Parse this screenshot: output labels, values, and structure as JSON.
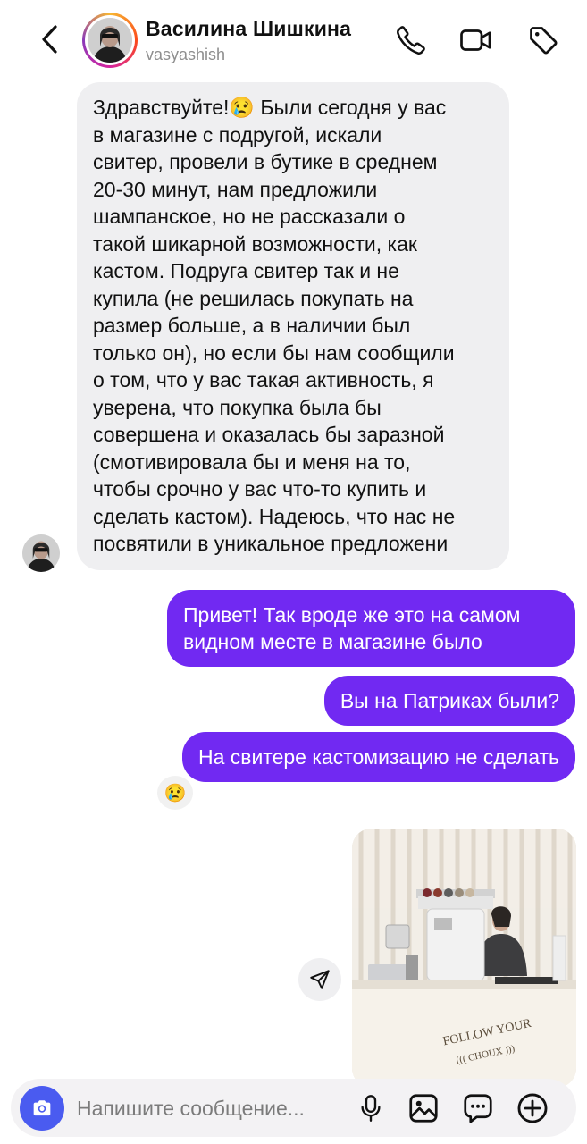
{
  "header": {
    "name": "Василина Шишкина",
    "username": "vasyashish",
    "icons": [
      "back-icon",
      "phone-icon",
      "video-camera-icon",
      "tag-icon"
    ]
  },
  "messages": [
    {
      "direction": "incoming",
      "text": "Здравствуйте!😢 Были сегодня у вас\nв магазине с подругой, искали\nсвитер, провели в бутике в среднем\n20-30 минут, нам предложили\nшампанское, но не рассказали о\nтакой шикарной возможности, как\nкастом. Подруга свитер так и не\nкупила (не решилась покупать на\nразмер больше, а в наличии был\nтолько он), но если бы нам сообщили\nо том, что у вас такая активность, я\nуверена, что покупка была бы\nсовершена и оказалась бы заразной\n(смотивировала бы и меня на то,\nчтобы срочно у вас что-то купить и\nсделать кастом). Надеюсь, что нас не\nпосвятили в уникальное предложени"
    },
    {
      "direction": "outgoing",
      "text": "Привет! Так вроде же это на самом\nвидном месте в магазине было"
    },
    {
      "direction": "outgoing",
      "text": "Вы на Патриках были?"
    },
    {
      "direction": "outgoing",
      "text": "На свитере кастомизацию не сделать"
    }
  ],
  "reaction": "😢",
  "photo": {
    "sign_line1": "FOLLOW YOUR",
    "sign_line2": "((( CHOUX )))"
  },
  "composer": {
    "placeholder": "Напишите сообщение...",
    "icons": [
      "camera-icon",
      "microphone-icon",
      "gallery-icon",
      "sticker-icon",
      "plus-icon"
    ]
  },
  "colors": {
    "outgoing_bubble": "#7129f2",
    "incoming_bubble": "#efeff1",
    "camera_button": "#4a5bf0"
  }
}
